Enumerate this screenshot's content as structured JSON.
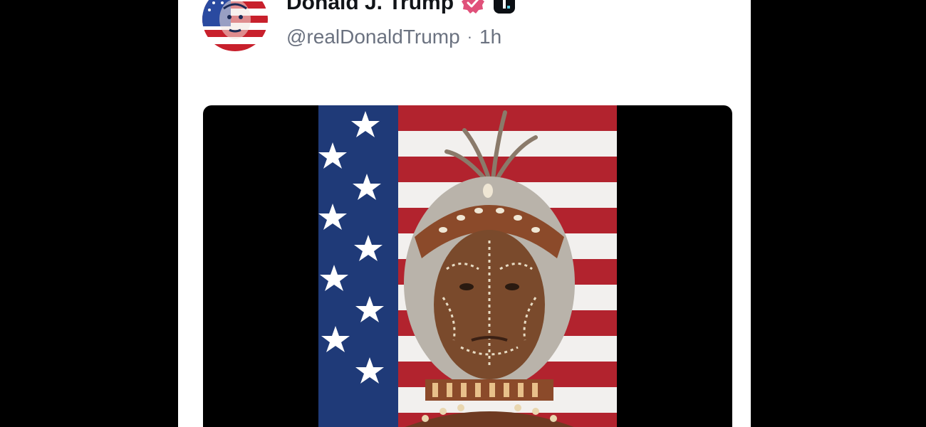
{
  "post": {
    "author": {
      "display_name": "Donald J. Trump",
      "handle": "@realDonaldTrump",
      "avatar_icon": "avatar-flag-face-icon"
    },
    "separator": "·",
    "timestamp": "1h",
    "badges": [
      {
        "icon": "verified-badge-icon",
        "color": "#e0517a"
      },
      {
        "icon": "truth-social-logo-icon",
        "color": "#0b0f14"
      }
    ],
    "media": {
      "type": "video",
      "description_icon": "flag-portrait-video-icon"
    }
  },
  "colors": {
    "background": "#000000",
    "card": "#ffffff",
    "text_primary": "#111418",
    "text_secondary": "#6b7280",
    "flag_red": "#b2232e",
    "flag_blue": "#1f3a78"
  }
}
